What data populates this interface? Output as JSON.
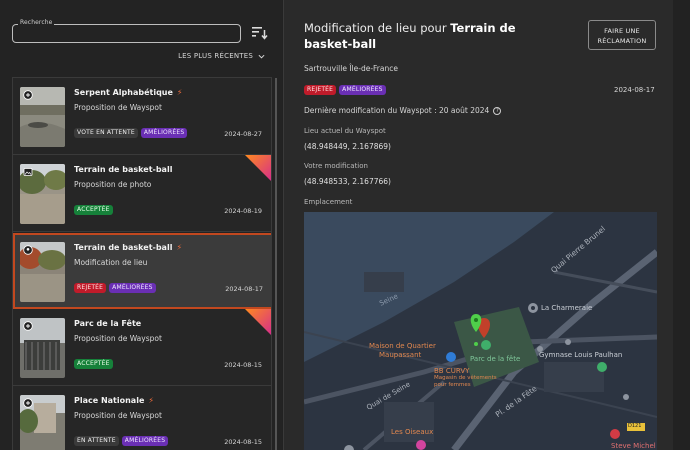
{
  "search": {
    "label": "Recherche",
    "value": ""
  },
  "filter": {
    "label": "LES PLUS RÉCENTES"
  },
  "items": [
    {
      "title": "Serpent Alphabétique",
      "bolt": "⚡",
      "subtitle": "Proposition de Wayspot",
      "badges": [
        "VOTE EN ATTENTE",
        "AMÉLIORÉES"
      ],
      "date": "2024-08-27"
    },
    {
      "title": "Terrain de basket-ball",
      "bolt": "",
      "subtitle": "Proposition de photo",
      "badges": [
        "ACCEPTÉE"
      ],
      "date": "2024-08-19"
    },
    {
      "title": "Terrain de basket-ball",
      "bolt": "⚡",
      "subtitle": "Modification de lieu",
      "badges": [
        "REJETÉE",
        "AMÉLIORÉES"
      ],
      "date": "2024-08-17"
    },
    {
      "title": "Parc de la Fête",
      "bolt": "",
      "subtitle": "Proposition de Wayspot",
      "badges": [
        "ACCEPTÉE"
      ],
      "date": "2024-08-15"
    },
    {
      "title": "Place Nationale",
      "bolt": "⚡",
      "subtitle": "Proposition de Wayspot",
      "badges": [
        "EN ATTENTE",
        "AMÉLIORÉES"
      ],
      "date": "2024-08-15"
    }
  ],
  "detail": {
    "title_prefix": "Modification de lieu pour ",
    "title_name": "Terrain de basket-ball",
    "claim_button": "FAIRE UNE RÉCLAMATION",
    "location": "Sartrouville Île-de-France",
    "badges": [
      "REJETÉE",
      "AMÉLIORÉES"
    ],
    "date": "2024-08-17",
    "last_modified": "Dernière modification du Wayspot : 20 août 2024",
    "current_label": "Lieu actuel du Wayspot",
    "current_value": "(48.948449, 2.167869)",
    "your_label": "Votre modification",
    "your_value": "(48.948533, 2.167766)",
    "map_label": "Emplacement"
  },
  "map": {
    "labels": {
      "quai_pierre_brunel": "Quai Pierre Brunel",
      "seine": "Seine",
      "la_charmeraie": "La Charmeraie",
      "maison_quartier": "Maison de Quartier",
      "maupassant": "Maupassant",
      "parc_fete": "Parc de la fête",
      "gymnase": "Gymnase Louis Paulhan",
      "bb_curvy": "BB CURVY",
      "bb_curvy_desc1": "Magasin de vêtements",
      "bb_curvy_desc2": "pour femmes",
      "quai_seine": "Quai de Seine",
      "pl_fete": "Pl. de la Fête",
      "les_oiseaux": "Les Oiseaux",
      "d121": "D121",
      "steve_michel": "Steve Michel"
    }
  }
}
